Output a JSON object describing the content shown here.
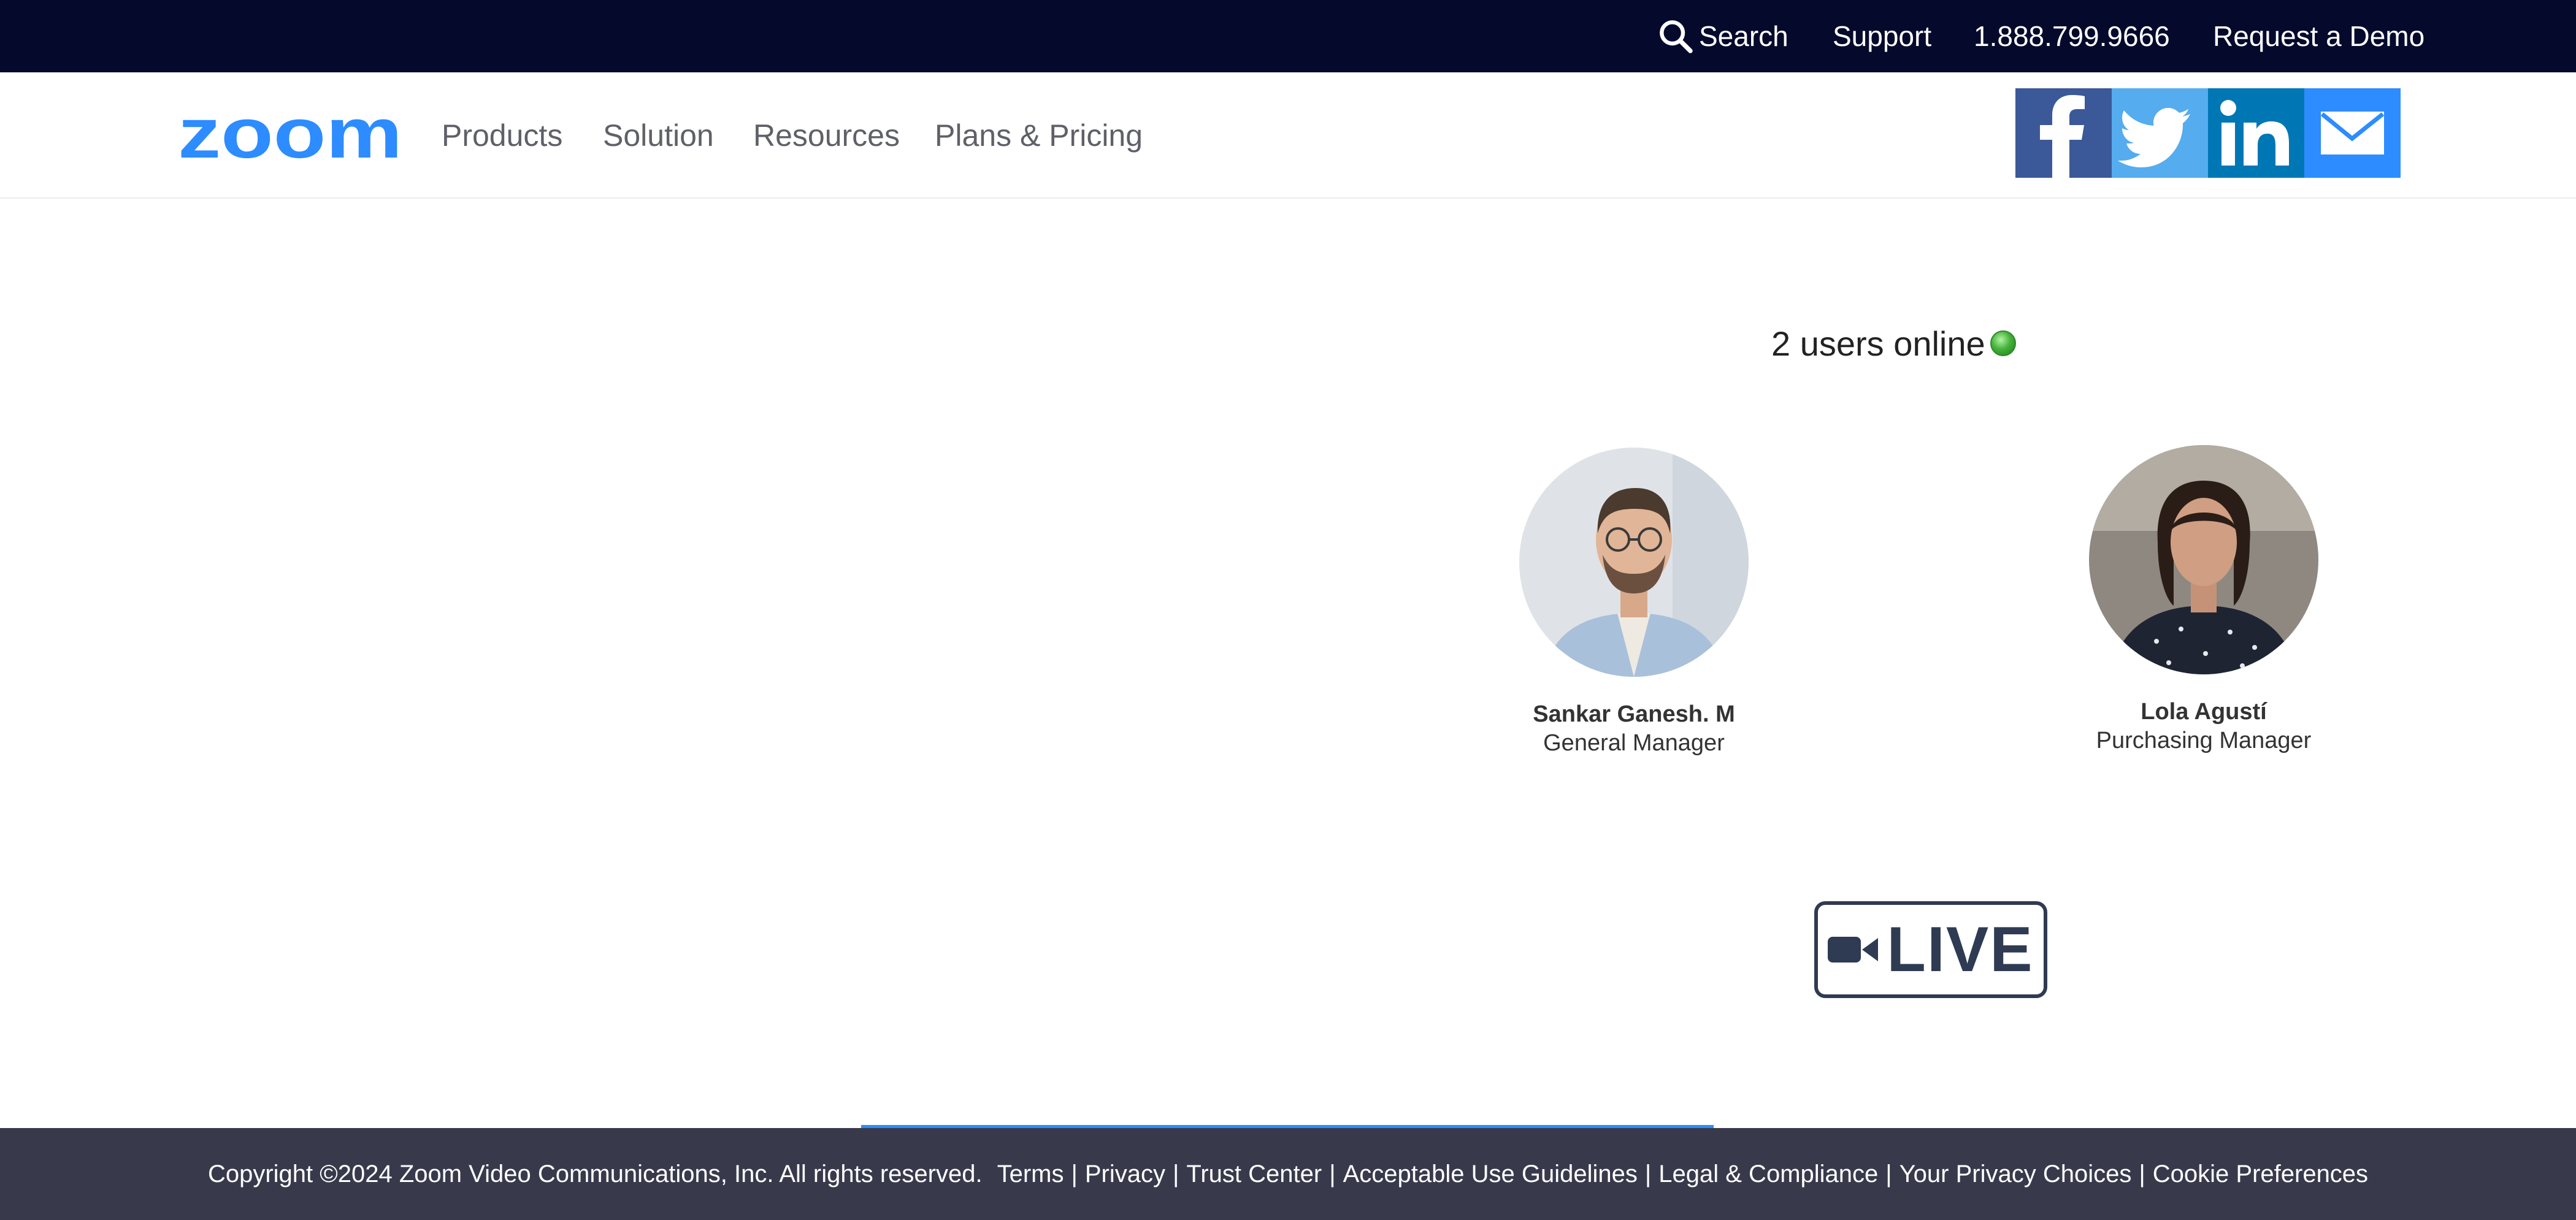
{
  "topbar": {
    "search_label": "Search",
    "support_label": "Support",
    "phone": "1.888.799.9666",
    "demo_label": "Request a Demo"
  },
  "brand": {
    "logo_text": "zoom",
    "logo_color": "#2d8cff"
  },
  "nav": {
    "items": [
      {
        "label": "Products"
      },
      {
        "label": "Solution"
      },
      {
        "label": "Resources"
      },
      {
        "label": "Plans & Pricing"
      }
    ]
  },
  "social": {
    "items": [
      {
        "icon": "facebook-icon",
        "color": "#3b5998"
      },
      {
        "icon": "twitter-icon",
        "color": "#55acee"
      },
      {
        "icon": "linkedin-icon",
        "color": "#0077b5"
      },
      {
        "icon": "email-icon",
        "color": "#2d8cff"
      }
    ]
  },
  "presence": {
    "text": "2 users online",
    "status_color": "#45b43a"
  },
  "people": [
    {
      "name": "Sankar Ganesh. M",
      "role": "General Manager"
    },
    {
      "name": "Lola Agustí",
      "role": "Purchasing Manager"
    }
  ],
  "live_badge": {
    "label": "LIVE",
    "icon": "video-camera-icon",
    "color": "#2f3b52"
  },
  "footer": {
    "copyright": "Copyright ©2024 Zoom Video Communications, Inc. All rights reserved.",
    "links": [
      "Terms",
      "Privacy",
      "Trust Center",
      "Acceptable Use Guidelines",
      "Legal & Compliance",
      "Your Privacy Choices",
      "Cookie Preferences"
    ],
    "background": "#383a4c"
  }
}
